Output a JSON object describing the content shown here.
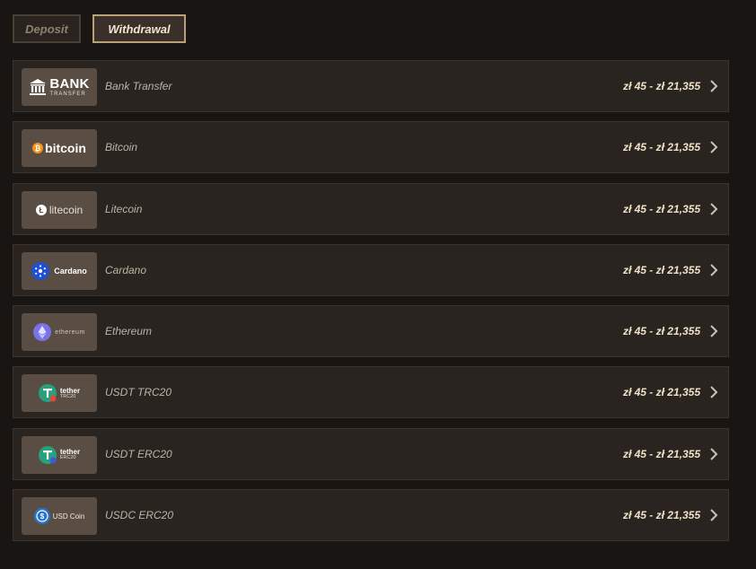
{
  "tabs": {
    "deposit_label": "Deposit",
    "withdrawal_label": "Withdrawal",
    "active": "withdrawal"
  },
  "methods": [
    {
      "name": "Bank Transfer",
      "range": "zł 45 - zł 21,355",
      "logo": {
        "big": "BANK",
        "small": "TRANSFER",
        "icon": "bank-building-icon"
      }
    },
    {
      "name": "Bitcoin",
      "range": "zł 45 - zł 21,355",
      "logo": {
        "word": "bitcoin",
        "icon": "bitcoin-icon"
      }
    },
    {
      "name": "Litecoin",
      "range": "zł 45 - zł 21,355",
      "logo": {
        "word": "litecoin",
        "icon": "litecoin-icon"
      }
    },
    {
      "name": "Cardano",
      "range": "zł 45 - zł 21,355",
      "logo": {
        "word": "Cardano",
        "icon": "cardano-icon"
      }
    },
    {
      "name": "Ethereum",
      "range": "zł 45 - zł 21,355",
      "logo": {
        "word": "ethereum",
        "icon": "ethereum-icon"
      }
    },
    {
      "name": "USDT TRC20",
      "range": "zł 45 - zł 21,355",
      "logo": {
        "big": "tether",
        "small": "TRC20",
        "icon": "tether-icon"
      }
    },
    {
      "name": "USDT ERC20",
      "range": "zł 45 - zł 21,355",
      "logo": {
        "big": "tether",
        "small": "ERC20",
        "icon": "tether-icon"
      }
    },
    {
      "name": "USDC ERC20",
      "range": "zł 45 - zł 21,355",
      "logo": {
        "word": "USD Coin",
        "icon": "usdc-icon"
      }
    }
  ],
  "colors": {
    "background": "#191512",
    "row_background": "#292420",
    "logo_background": "#5a4d43",
    "accent_border": "#b8a079",
    "range_text": "#f0e2c8"
  }
}
